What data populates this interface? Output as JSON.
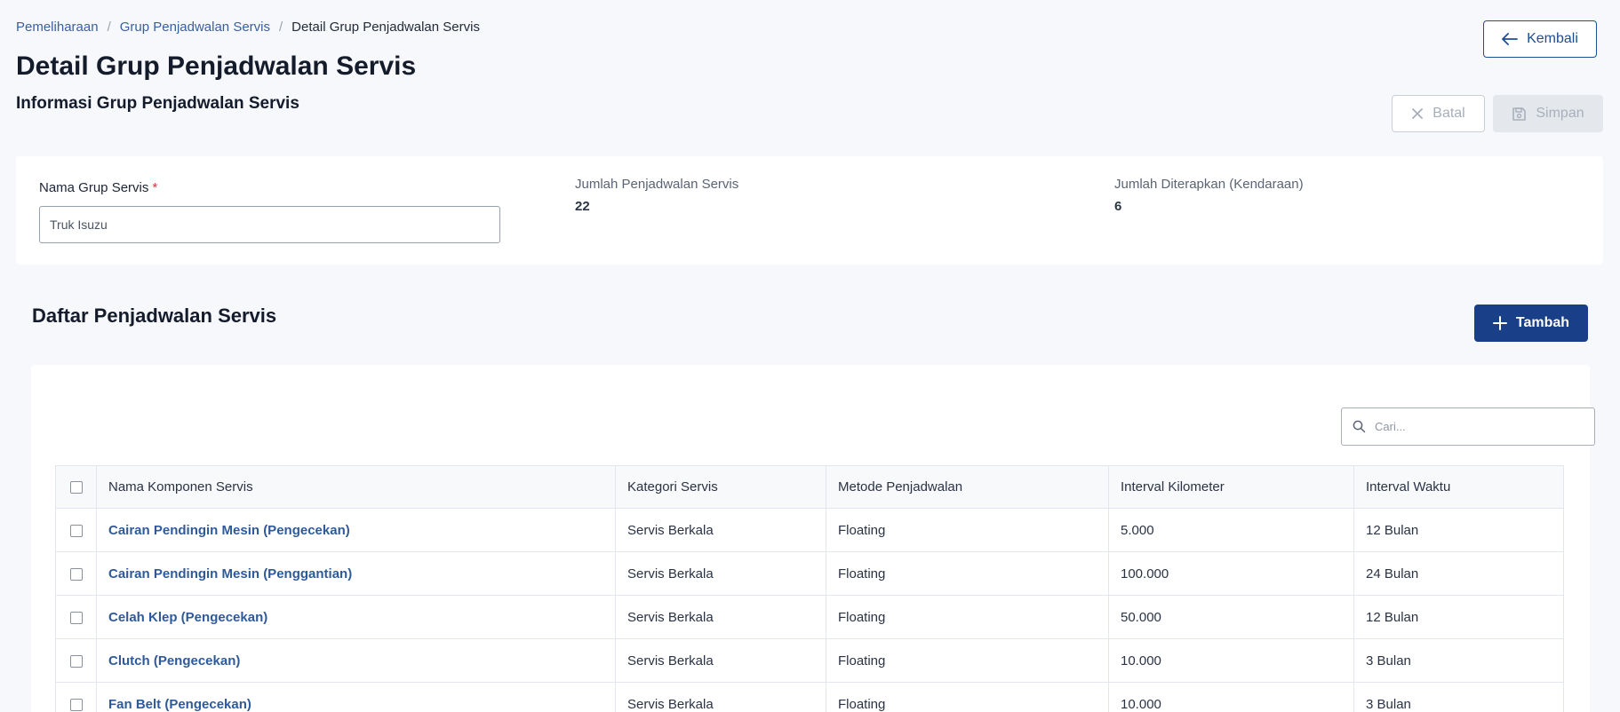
{
  "breadcrumb": {
    "items": [
      "Pemeliharaan",
      "Grup Penjadwalan Servis"
    ],
    "current": "Detail Grup Penjadwalan Servis",
    "separator": "/"
  },
  "page": {
    "title": "Detail Grup Penjadwalan Servis",
    "section_title": "Informasi Grup Penjadwalan Servis"
  },
  "buttons": {
    "back_label": "Kembali",
    "cancel_label": "Batal",
    "save_label": "Simpan",
    "add_label": "Tambah"
  },
  "form": {
    "name_label": "Nama Grup Servis",
    "required_mark": "*",
    "name_value": "Truk Isuzu"
  },
  "stats": {
    "schedules_label": "Jumlah Penjadwalan Servis",
    "schedules_value": "22",
    "applied_label": "Jumlah Diterapkan (Kendaraan)",
    "applied_value": "6"
  },
  "list": {
    "title": "Daftar Penjadwalan Servis",
    "search_placeholder": "Cari...",
    "columns": [
      "Nama Komponen Servis",
      "Kategori Servis",
      "Metode Penjadwalan",
      "Interval Kilometer",
      "Interval Waktu"
    ],
    "rows": [
      [
        "Cairan Pendingin Mesin (Pengecekan)",
        "Servis Berkala",
        "Floating",
        "5.000",
        "12 Bulan"
      ],
      [
        "Cairan Pendingin Mesin (Penggantian)",
        "Servis Berkala",
        "Floating",
        "100.000",
        "24 Bulan"
      ],
      [
        "Celah Klep (Pengecekan)",
        "Servis Berkala",
        "Floating",
        "50.000",
        "12 Bulan"
      ],
      [
        "Clutch (Pengecekan)",
        "Servis Berkala",
        "Floating",
        "10.000",
        "3 Bulan"
      ],
      [
        "Fan Belt (Pengecekan)",
        "Servis Berkala",
        "Floating",
        "10.000",
        "3 Bulan"
      ]
    ]
  },
  "colors": {
    "primary": "#183f88",
    "link": "#2f5a9a",
    "required": "#d93a3a"
  },
  "icons": {
    "back": "arrow-left-icon",
    "cancel": "close-icon",
    "save": "floppy-disk-icon",
    "add": "plus-icon",
    "search": "search-icon"
  }
}
